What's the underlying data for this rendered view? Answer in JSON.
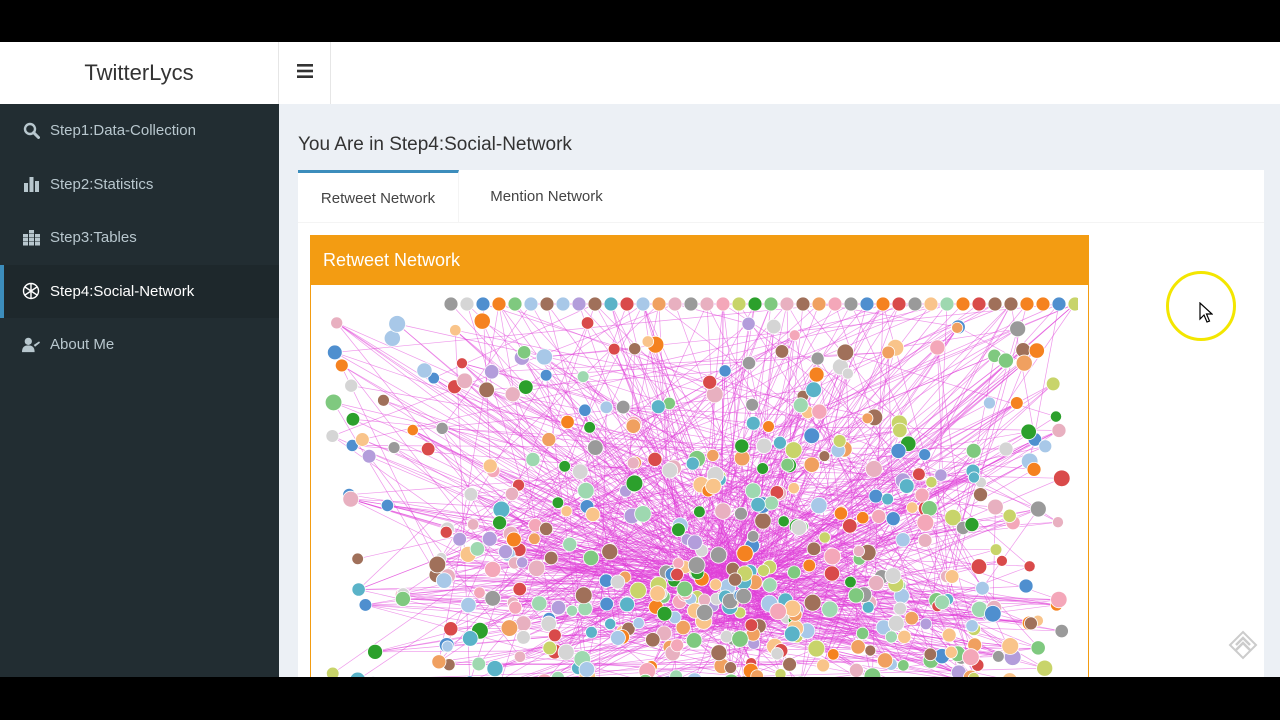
{
  "app": {
    "title": "TwitterLycs"
  },
  "header": {
    "toggle_icon": "hamburger-icon"
  },
  "sidebar": {
    "items": [
      {
        "label": "Step1:Data-Collection",
        "icon": "search-icon",
        "active": false
      },
      {
        "label": "Step2:Statistics",
        "icon": "bar-chart-icon",
        "active": false
      },
      {
        "label": "Step3:Tables",
        "icon": "table-icon",
        "active": false
      },
      {
        "label": "Step4:Social-Network",
        "icon": "network-icon",
        "active": true
      },
      {
        "label": "About Me",
        "icon": "user-icon",
        "active": false
      }
    ]
  },
  "main": {
    "page_title": "You Are in Step4:Social-Network",
    "tabs": [
      {
        "label": "Retweet Network",
        "active": true
      },
      {
        "label": "Mention Network",
        "active": false
      }
    ],
    "panel": {
      "title": "Retweet Network"
    }
  },
  "colors": {
    "sidebar_bg": "#222d32",
    "sidebar_active_bg": "#1e282c",
    "accent": "#3c8dbc",
    "panel_header": "#f39c12",
    "edge": "#e040d8",
    "cursor_highlight": "#f3e600"
  }
}
